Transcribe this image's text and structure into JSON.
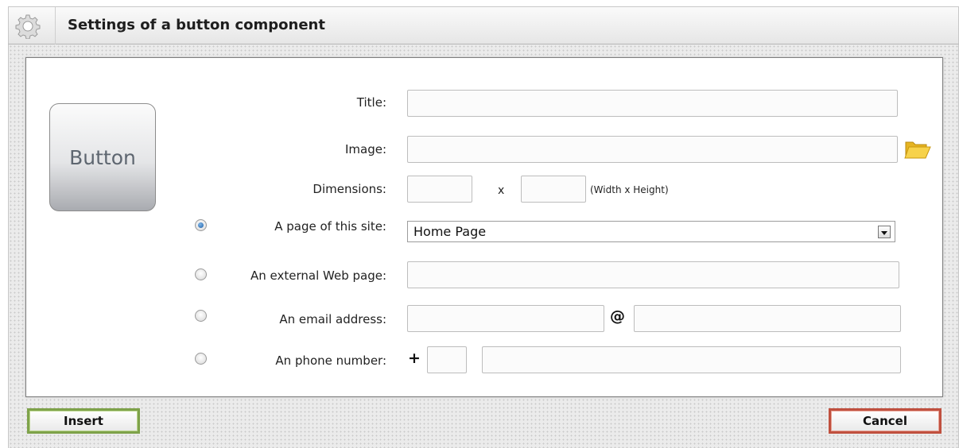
{
  "dialog": {
    "title": "Settings of a button component",
    "icon": "gear-icon"
  },
  "preview": {
    "label": "Button"
  },
  "form": {
    "title_label": "Title:",
    "title_value": "",
    "image_label": "Image:",
    "image_value": "",
    "image_browse_icon": "folder-icon",
    "dimensions_label": "Dimensions:",
    "width_value": "",
    "height_value": "",
    "dimensions_separator": "x",
    "dimensions_hint": "(Width x Height)",
    "link_options": [
      {
        "label": "A page of this site:",
        "checked": true
      },
      {
        "label": "An external Web page:",
        "checked": false
      },
      {
        "label": "An email address:",
        "checked": false
      },
      {
        "label": "An phone number:",
        "checked": false
      }
    ],
    "page_select_value": "Home Page",
    "external_url_value": "",
    "email_user_value": "",
    "email_at": "@",
    "email_domain_value": "",
    "phone_plus": "+",
    "phone_code_value": "",
    "phone_number_value": ""
  },
  "actions": {
    "insert_label": "Insert",
    "cancel_label": "Cancel",
    "insert_color": "#7ea24a",
    "cancel_color": "#c0503f"
  }
}
